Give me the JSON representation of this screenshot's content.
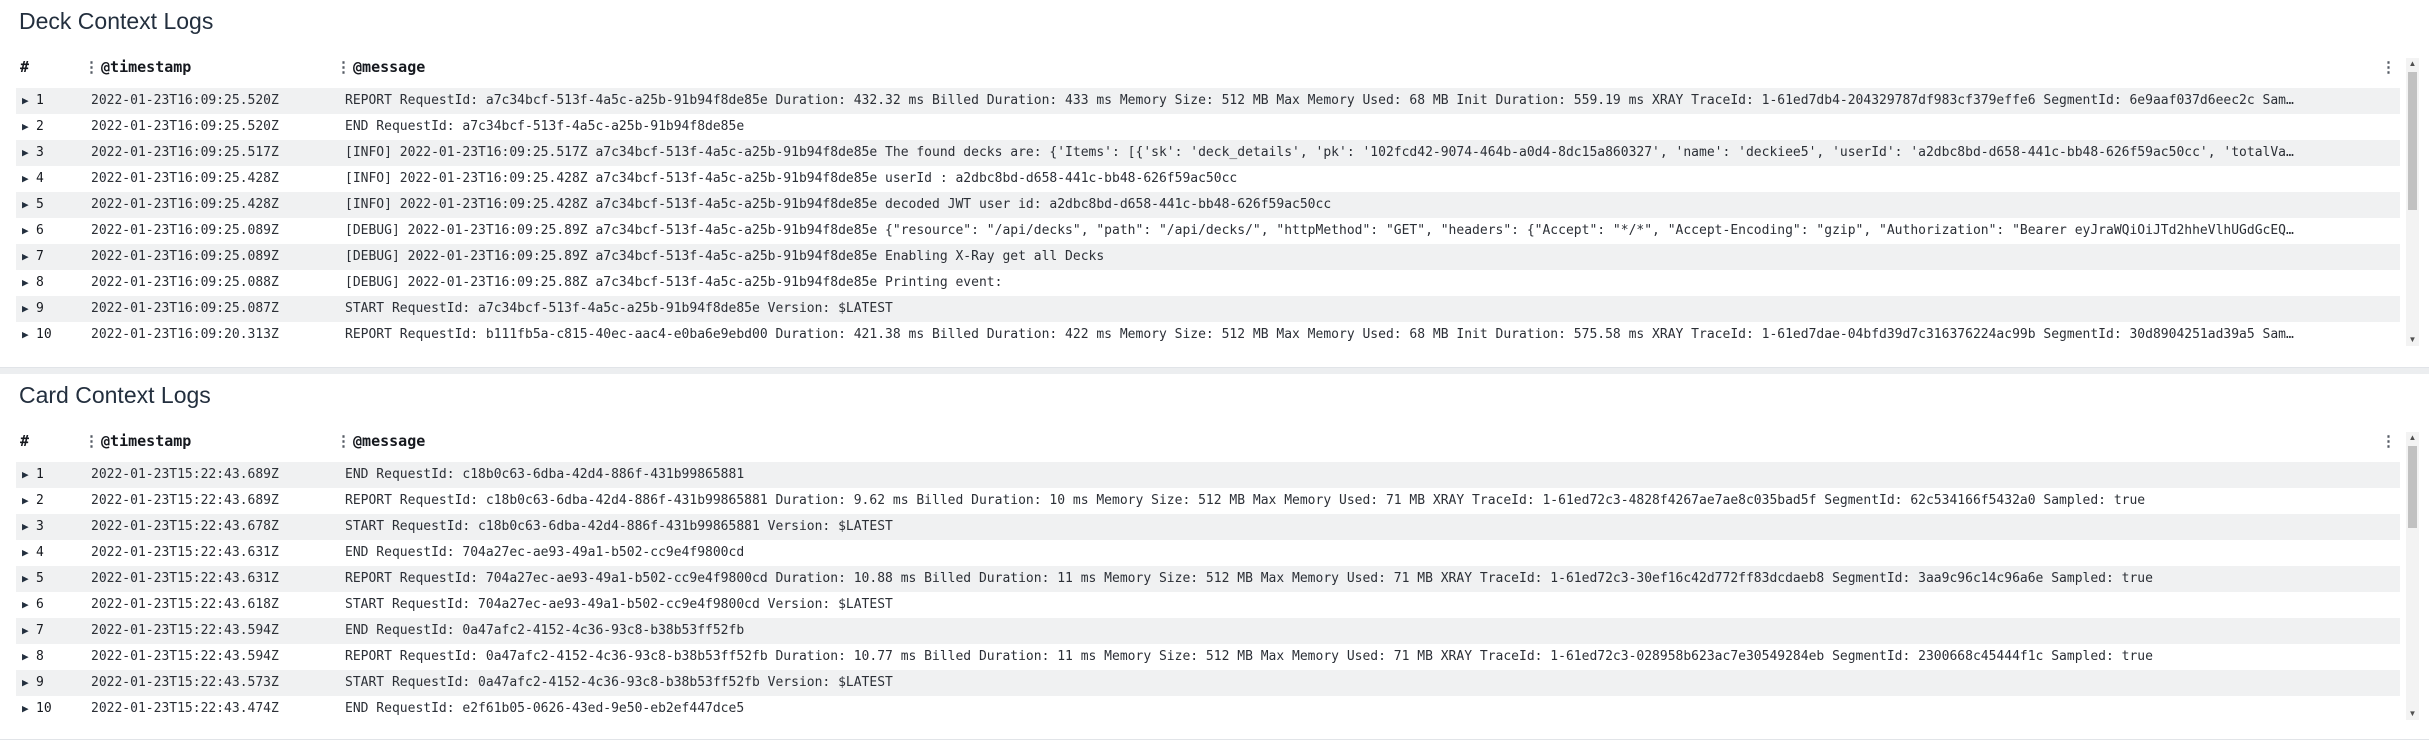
{
  "deck_panel": {
    "title": "Deck Context Logs",
    "columns": {
      "num": "#",
      "timestamp": "@timestamp",
      "message": "@message"
    },
    "rows": [
      {
        "num": "1",
        "timestamp": "2022-01-23T16:09:25.520Z",
        "message": "REPORT RequestId: a7c34bcf-513f-4a5c-a25b-91b94f8de85e Duration: 432.32 ms Billed Duration: 433 ms Memory Size: 512 MB Max Memory Used: 68 MB Init Duration: 559.19 ms XRAY TraceId: 1-61ed7db4-204329787df983cf379effe6 SegmentId: 6e9aaf037d6eec2c Sam…"
      },
      {
        "num": "2",
        "timestamp": "2022-01-23T16:09:25.520Z",
        "message": "END RequestId: a7c34bcf-513f-4a5c-a25b-91b94f8de85e"
      },
      {
        "num": "3",
        "timestamp": "2022-01-23T16:09:25.517Z",
        "message": "[INFO] 2022-01-23T16:09:25.517Z a7c34bcf-513f-4a5c-a25b-91b94f8de85e The found decks are: {'Items': [{'sk': 'deck_details', 'pk': '102fcd42-9074-464b-a0d4-8dc15a860327', 'name': 'deckiee5', 'userId': 'a2dbc8bd-d658-441c-bb48-626f59ac50cc', 'totalVa…"
      },
      {
        "num": "4",
        "timestamp": "2022-01-23T16:09:25.428Z",
        "message": "[INFO] 2022-01-23T16:09:25.428Z a7c34bcf-513f-4a5c-a25b-91b94f8de85e userId : a2dbc8bd-d658-441c-bb48-626f59ac50cc"
      },
      {
        "num": "5",
        "timestamp": "2022-01-23T16:09:25.428Z",
        "message": "[INFO] 2022-01-23T16:09:25.428Z a7c34bcf-513f-4a5c-a25b-91b94f8de85e decoded JWT user id: a2dbc8bd-d658-441c-bb48-626f59ac50cc"
      },
      {
        "num": "6",
        "timestamp": "2022-01-23T16:09:25.089Z",
        "message": "[DEBUG] 2022-01-23T16:09:25.89Z a7c34bcf-513f-4a5c-a25b-91b94f8de85e {\"resource\": \"/api/decks\", \"path\": \"/api/decks/\", \"httpMethod\": \"GET\", \"headers\": {\"Accept\": \"*/*\", \"Accept-Encoding\": \"gzip\", \"Authorization\": \"Bearer eyJraWQiOiJTd2hheVlhUGdGcEQ…"
      },
      {
        "num": "7",
        "timestamp": "2022-01-23T16:09:25.089Z",
        "message": "[DEBUG] 2022-01-23T16:09:25.89Z a7c34bcf-513f-4a5c-a25b-91b94f8de85e Enabling X-Ray get all Decks"
      },
      {
        "num": "8",
        "timestamp": "2022-01-23T16:09:25.088Z",
        "message": "[DEBUG] 2022-01-23T16:09:25.88Z a7c34bcf-513f-4a5c-a25b-91b94f8de85e Printing event:"
      },
      {
        "num": "9",
        "timestamp": "2022-01-23T16:09:25.087Z",
        "message": "START RequestId: a7c34bcf-513f-4a5c-a25b-91b94f8de85e Version: $LATEST"
      },
      {
        "num": "10",
        "timestamp": "2022-01-23T16:09:20.313Z",
        "message": "REPORT RequestId: b111fb5a-c815-40ec-aac4-e0ba6e9ebd00 Duration: 421.38 ms Billed Duration: 422 ms Memory Size: 512 MB Max Memory Used: 68 MB Init Duration: 575.58 ms XRAY TraceId: 1-61ed7dae-04bfd39d7c316376224ac99b SegmentId: 30d8904251ad39a5 Sam…"
      }
    ]
  },
  "card_panel": {
    "title": "Card Context Logs",
    "columns": {
      "num": "#",
      "timestamp": "@timestamp",
      "message": "@message"
    },
    "rows": [
      {
        "num": "1",
        "timestamp": "2022-01-23T15:22:43.689Z",
        "message": "END RequestId: c18b0c63-6dba-42d4-886f-431b99865881"
      },
      {
        "num": "2",
        "timestamp": "2022-01-23T15:22:43.689Z",
        "message": "REPORT RequestId: c18b0c63-6dba-42d4-886f-431b99865881 Duration: 9.62 ms Billed Duration: 10 ms Memory Size: 512 MB Max Memory Used: 71 MB XRAY TraceId: 1-61ed72c3-4828f4267ae7ae8c035bad5f SegmentId: 62c534166f5432a0 Sampled: true"
      },
      {
        "num": "3",
        "timestamp": "2022-01-23T15:22:43.678Z",
        "message": "START RequestId: c18b0c63-6dba-42d4-886f-431b99865881 Version: $LATEST"
      },
      {
        "num": "4",
        "timestamp": "2022-01-23T15:22:43.631Z",
        "message": "END RequestId: 704a27ec-ae93-49a1-b502-cc9e4f9800cd"
      },
      {
        "num": "5",
        "timestamp": "2022-01-23T15:22:43.631Z",
        "message": "REPORT RequestId: 704a27ec-ae93-49a1-b502-cc9e4f9800cd Duration: 10.88 ms Billed Duration: 11 ms Memory Size: 512 MB Max Memory Used: 71 MB XRAY TraceId: 1-61ed72c3-30ef16c42d772ff83dcdaeb8 SegmentId: 3aa9c96c14c96a6e Sampled: true"
      },
      {
        "num": "6",
        "timestamp": "2022-01-23T15:22:43.618Z",
        "message": "START RequestId: 704a27ec-ae93-49a1-b502-cc9e4f9800cd Version: $LATEST"
      },
      {
        "num": "7",
        "timestamp": "2022-01-23T15:22:43.594Z",
        "message": "END RequestId: 0a47afc2-4152-4c36-93c8-b38b53ff52fb"
      },
      {
        "num": "8",
        "timestamp": "2022-01-23T15:22:43.594Z",
        "message": "REPORT RequestId: 0a47afc2-4152-4c36-93c8-b38b53ff52fb Duration: 10.77 ms Billed Duration: 11 ms Memory Size: 512 MB Max Memory Used: 71 MB XRAY TraceId: 1-61ed72c3-028958b623ac7e30549284eb SegmentId: 2300668c45444f1c Sampled: true"
      },
      {
        "num": "9",
        "timestamp": "2022-01-23T15:22:43.573Z",
        "message": "START RequestId: 0a47afc2-4152-4c36-93c8-b38b53ff52fb Version: $LATEST"
      },
      {
        "num": "10",
        "timestamp": "2022-01-23T15:22:43.474Z",
        "message": "END RequestId: e2f61b05-0626-43ed-9e50-eb2ef447dce5"
      }
    ]
  },
  "icons": {
    "expand": "caret-right-icon",
    "column_resize": "column-handle-icon",
    "table_menu": "kebab-menu-icon"
  }
}
